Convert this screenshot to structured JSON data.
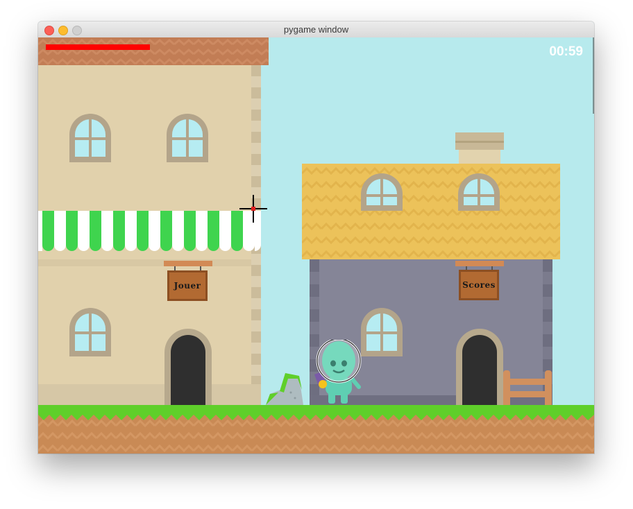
{
  "window": {
    "title": "pygame window"
  },
  "hud": {
    "timer": "00:59",
    "health_percent": 100,
    "health_color": "#ff0000"
  },
  "signs": {
    "play": "Jouer",
    "scores": "Scores"
  },
  "colors": {
    "sky": "#b7eaed",
    "grass": "#5fcf2a",
    "dirt": "#c98a55",
    "awning_green": "#3fd44e",
    "roof_yellow": "#ecc25a",
    "roof_red": "#c27d55",
    "wall_beige": "#e1d1ac",
    "wall_gray": "#858597"
  },
  "icons": {
    "cursor": "crosshair-icon",
    "player": "alien-astronaut-icon"
  }
}
